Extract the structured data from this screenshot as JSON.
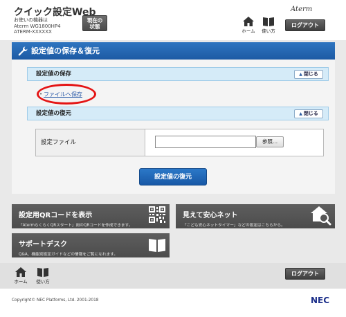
{
  "header": {
    "app_title": "クイック設定Web",
    "device_line1": "お使いの機器は",
    "device_line2": "Aterm WG1800HP4",
    "device_line3": "ATERM-XXXXXX",
    "status_button": "現在の\n状態",
    "brand": "Aterm",
    "home_label": "ホーム",
    "manual_label": "使い方",
    "logout_label": "ログアウト"
  },
  "panel": {
    "title": "設定値の保存＆復元",
    "save_section": {
      "title": "設定値の保存",
      "close_label": "閉じる",
      "link": "ファイルへ保存"
    },
    "restore_section": {
      "title": "設定値の復元",
      "close_label": "閉じる",
      "file_label": "設定ファイル",
      "file_value": "",
      "browse_label": "参照..."
    },
    "restore_button": "設定値の復元"
  },
  "tiles": [
    {
      "title": "設定用QRコードを表示",
      "desc": "「AtermらくらくQRスタート」用のQRコードを作成できます。",
      "icon": "qr-code-icon"
    },
    {
      "title": "見えて安心ネット",
      "desc": "「こども安心ネットタイマー」などの設定はこちらから。",
      "icon": "home-search-icon"
    },
    {
      "title": "サポートデスク",
      "desc": "Q&A、機能別設定ガイドなどの情報をご覧になれます。",
      "icon": "book-icon"
    }
  ],
  "footer": {
    "home_label": "ホーム",
    "manual_label": "使い方",
    "logout_label": "ログアウト",
    "copyright": "Copyright© NEC Platforms, Ltd. 2001-2018",
    "logo": "NEC"
  },
  "colors": {
    "accent_blue": "#1d5aa4",
    "section_bg": "#d5ebf8",
    "tile_bg": "#555555",
    "highlight_red": "#e41414"
  }
}
